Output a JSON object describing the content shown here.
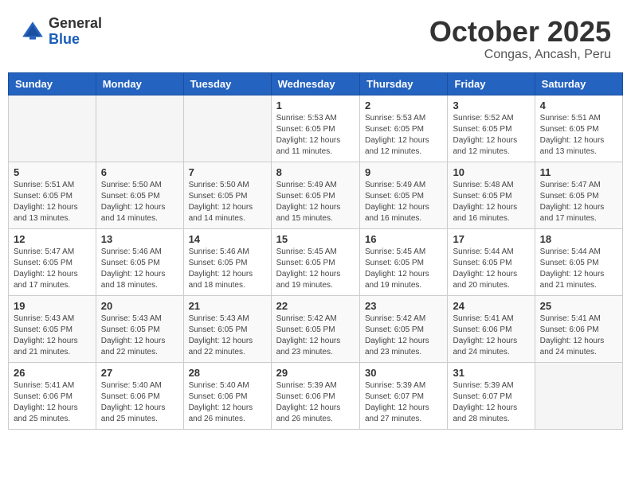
{
  "header": {
    "logo_general": "General",
    "logo_blue": "Blue",
    "month_title": "October 2025",
    "location": "Congas, Ancash, Peru"
  },
  "weekdays": [
    "Sunday",
    "Monday",
    "Tuesday",
    "Wednesday",
    "Thursday",
    "Friday",
    "Saturday"
  ],
  "weeks": [
    [
      {
        "day": "",
        "sunrise": "",
        "sunset": "",
        "daylight": ""
      },
      {
        "day": "",
        "sunrise": "",
        "sunset": "",
        "daylight": ""
      },
      {
        "day": "",
        "sunrise": "",
        "sunset": "",
        "daylight": ""
      },
      {
        "day": "1",
        "sunrise": "Sunrise: 5:53 AM",
        "sunset": "Sunset: 6:05 PM",
        "daylight": "Daylight: 12 hours and 11 minutes."
      },
      {
        "day": "2",
        "sunrise": "Sunrise: 5:53 AM",
        "sunset": "Sunset: 6:05 PM",
        "daylight": "Daylight: 12 hours and 12 minutes."
      },
      {
        "day": "3",
        "sunrise": "Sunrise: 5:52 AM",
        "sunset": "Sunset: 6:05 PM",
        "daylight": "Daylight: 12 hours and 12 minutes."
      },
      {
        "day": "4",
        "sunrise": "Sunrise: 5:51 AM",
        "sunset": "Sunset: 6:05 PM",
        "daylight": "Daylight: 12 hours and 13 minutes."
      }
    ],
    [
      {
        "day": "5",
        "sunrise": "Sunrise: 5:51 AM",
        "sunset": "Sunset: 6:05 PM",
        "daylight": "Daylight: 12 hours and 13 minutes."
      },
      {
        "day": "6",
        "sunrise": "Sunrise: 5:50 AM",
        "sunset": "Sunset: 6:05 PM",
        "daylight": "Daylight: 12 hours and 14 minutes."
      },
      {
        "day": "7",
        "sunrise": "Sunrise: 5:50 AM",
        "sunset": "Sunset: 6:05 PM",
        "daylight": "Daylight: 12 hours and 14 minutes."
      },
      {
        "day": "8",
        "sunrise": "Sunrise: 5:49 AM",
        "sunset": "Sunset: 6:05 PM",
        "daylight": "Daylight: 12 hours and 15 minutes."
      },
      {
        "day": "9",
        "sunrise": "Sunrise: 5:49 AM",
        "sunset": "Sunset: 6:05 PM",
        "daylight": "Daylight: 12 hours and 16 minutes."
      },
      {
        "day": "10",
        "sunrise": "Sunrise: 5:48 AM",
        "sunset": "Sunset: 6:05 PM",
        "daylight": "Daylight: 12 hours and 16 minutes."
      },
      {
        "day": "11",
        "sunrise": "Sunrise: 5:47 AM",
        "sunset": "Sunset: 6:05 PM",
        "daylight": "Daylight: 12 hours and 17 minutes."
      }
    ],
    [
      {
        "day": "12",
        "sunrise": "Sunrise: 5:47 AM",
        "sunset": "Sunset: 6:05 PM",
        "daylight": "Daylight: 12 hours and 17 minutes."
      },
      {
        "day": "13",
        "sunrise": "Sunrise: 5:46 AM",
        "sunset": "Sunset: 6:05 PM",
        "daylight": "Daylight: 12 hours and 18 minutes."
      },
      {
        "day": "14",
        "sunrise": "Sunrise: 5:46 AM",
        "sunset": "Sunset: 6:05 PM",
        "daylight": "Daylight: 12 hours and 18 minutes."
      },
      {
        "day": "15",
        "sunrise": "Sunrise: 5:45 AM",
        "sunset": "Sunset: 6:05 PM",
        "daylight": "Daylight: 12 hours and 19 minutes."
      },
      {
        "day": "16",
        "sunrise": "Sunrise: 5:45 AM",
        "sunset": "Sunset: 6:05 PM",
        "daylight": "Daylight: 12 hours and 19 minutes."
      },
      {
        "day": "17",
        "sunrise": "Sunrise: 5:44 AM",
        "sunset": "Sunset: 6:05 PM",
        "daylight": "Daylight: 12 hours and 20 minutes."
      },
      {
        "day": "18",
        "sunrise": "Sunrise: 5:44 AM",
        "sunset": "Sunset: 6:05 PM",
        "daylight": "Daylight: 12 hours and 21 minutes."
      }
    ],
    [
      {
        "day": "19",
        "sunrise": "Sunrise: 5:43 AM",
        "sunset": "Sunset: 6:05 PM",
        "daylight": "Daylight: 12 hours and 21 minutes."
      },
      {
        "day": "20",
        "sunrise": "Sunrise: 5:43 AM",
        "sunset": "Sunset: 6:05 PM",
        "daylight": "Daylight: 12 hours and 22 minutes."
      },
      {
        "day": "21",
        "sunrise": "Sunrise: 5:43 AM",
        "sunset": "Sunset: 6:05 PM",
        "daylight": "Daylight: 12 hours and 22 minutes."
      },
      {
        "day": "22",
        "sunrise": "Sunrise: 5:42 AM",
        "sunset": "Sunset: 6:05 PM",
        "daylight": "Daylight: 12 hours and 23 minutes."
      },
      {
        "day": "23",
        "sunrise": "Sunrise: 5:42 AM",
        "sunset": "Sunset: 6:05 PM",
        "daylight": "Daylight: 12 hours and 23 minutes."
      },
      {
        "day": "24",
        "sunrise": "Sunrise: 5:41 AM",
        "sunset": "Sunset: 6:06 PM",
        "daylight": "Daylight: 12 hours and 24 minutes."
      },
      {
        "day": "25",
        "sunrise": "Sunrise: 5:41 AM",
        "sunset": "Sunset: 6:06 PM",
        "daylight": "Daylight: 12 hours and 24 minutes."
      }
    ],
    [
      {
        "day": "26",
        "sunrise": "Sunrise: 5:41 AM",
        "sunset": "Sunset: 6:06 PM",
        "daylight": "Daylight: 12 hours and 25 minutes."
      },
      {
        "day": "27",
        "sunrise": "Sunrise: 5:40 AM",
        "sunset": "Sunset: 6:06 PM",
        "daylight": "Daylight: 12 hours and 25 minutes."
      },
      {
        "day": "28",
        "sunrise": "Sunrise: 5:40 AM",
        "sunset": "Sunset: 6:06 PM",
        "daylight": "Daylight: 12 hours and 26 minutes."
      },
      {
        "day": "29",
        "sunrise": "Sunrise: 5:39 AM",
        "sunset": "Sunset: 6:06 PM",
        "daylight": "Daylight: 12 hours and 26 minutes."
      },
      {
        "day": "30",
        "sunrise": "Sunrise: 5:39 AM",
        "sunset": "Sunset: 6:07 PM",
        "daylight": "Daylight: 12 hours and 27 minutes."
      },
      {
        "day": "31",
        "sunrise": "Sunrise: 5:39 AM",
        "sunset": "Sunset: 6:07 PM",
        "daylight": "Daylight: 12 hours and 28 minutes."
      },
      {
        "day": "",
        "sunrise": "",
        "sunset": "",
        "daylight": ""
      }
    ]
  ]
}
